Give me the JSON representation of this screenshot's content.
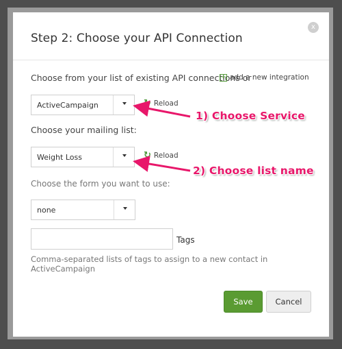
{
  "dialog": {
    "title": "Step 2: Choose your API Connection",
    "close_symbol": "x"
  },
  "intro": {
    "text": "Choose from your list of existing API connections or",
    "add_integration_label": "add a new integration"
  },
  "service_select": {
    "value": "ActiveCampaign",
    "reload_label": "Reload"
  },
  "mailing_list": {
    "label": "Choose your mailing list:",
    "value": "Weight Loss",
    "reload_label": "Reload"
  },
  "form_select": {
    "label": "Choose the form you want to use:",
    "value": "none"
  },
  "tags": {
    "value": "",
    "label": "Tags",
    "help": "Comma-separated lists of tags to assign to a new contact in ActiveCampaign"
  },
  "buttons": {
    "save_label": "Save",
    "cancel_label": "Cancel"
  },
  "annotations": {
    "first": "1) Choose Service",
    "second": "2) Choose list name",
    "color": "#e8176a"
  },
  "icons": [
    "close-icon",
    "plus-icon",
    "reload-icon",
    "caret-down-icon",
    "arrow-icon"
  ]
}
